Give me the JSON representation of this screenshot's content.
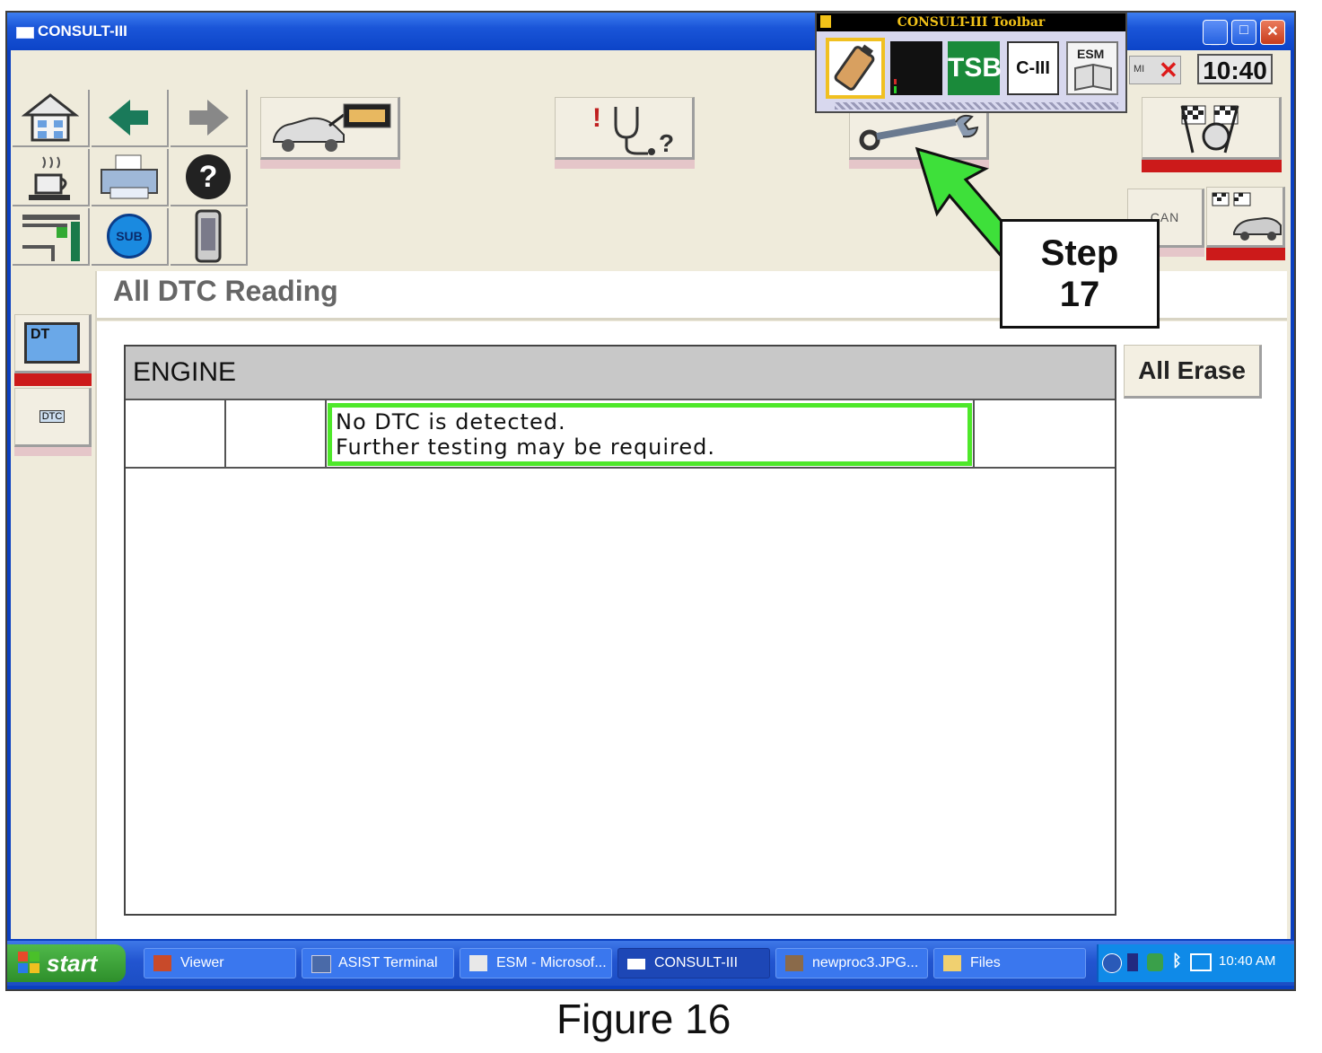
{
  "window": {
    "title": "CONSULT-III"
  },
  "toolbar_popup": {
    "title": "CONSULT-III Toolbar",
    "icons": [
      {
        "name": "battery-icon",
        "label": ""
      },
      {
        "name": "signal-meter-icon",
        "label": ""
      },
      {
        "name": "tsb-icon",
        "label": "TSB"
      },
      {
        "name": "c3-icon",
        "label": "C-III"
      },
      {
        "name": "esm-icon",
        "label": "ESM"
      }
    ]
  },
  "header": {
    "clock": "10:40",
    "mi_label": "MI"
  },
  "nav": {
    "sub_label": "SUB",
    "dtc_label": "DT",
    "dtc_small": "DTC"
  },
  "side_buttons": {
    "can_label": "CAN"
  },
  "page": {
    "heading": "All DTC Reading",
    "erase_button": "All Erase",
    "table": {
      "column_header": "ENGINE",
      "row_message_line1": "No DTC is detected.",
      "row_message_line2": "Further testing may be required."
    }
  },
  "callout": {
    "line1": "Step",
    "line2": "17"
  },
  "taskbar": {
    "start": "start",
    "tasks": [
      "Viewer",
      "ASIST Terminal",
      "ESM - Microsof...",
      "CONSULT-III",
      "newproc3.JPG...",
      "Files"
    ],
    "active_task": "CONSULT-III",
    "time": "10:40 AM"
  },
  "caption": "Figure 16",
  "colors": {
    "highlight_green": "#4ee82a",
    "arrow_green": "#3ee03a",
    "indicator_red": "#cc1a1a"
  }
}
